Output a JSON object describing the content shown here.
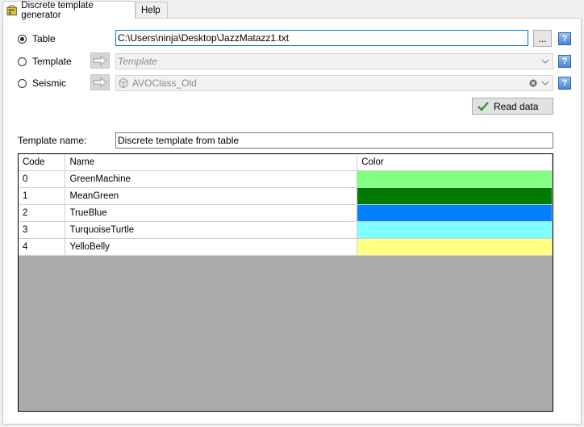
{
  "tabs": [
    {
      "label": "Discrete template generator",
      "active": true
    },
    {
      "label": "Help",
      "active": false
    }
  ],
  "source": {
    "table_label": "Table",
    "template_label": "Template",
    "seismic_label": "Seismic",
    "table_path": "C:\\Users\\ninja\\Desktop\\JazzMatazz1.txt",
    "browse_label": "...",
    "template_placeholder": "Template",
    "seismic_value": "AVOClass_Old",
    "selected": "Table"
  },
  "read_data_label": "Read data",
  "template_name": {
    "label": "Template name:",
    "value": "Discrete template from table"
  },
  "grid": {
    "columns": [
      "Code",
      "Name",
      "Color"
    ],
    "rows": [
      {
        "code": "0",
        "name": "GreenMachine",
        "color": "#80ff80"
      },
      {
        "code": "1",
        "name": "MeanGreen",
        "color": "#007a00"
      },
      {
        "code": "2",
        "name": "TrueBlue",
        "color": "#0080ff"
      },
      {
        "code": "3",
        "name": "TurquoiseTurtle",
        "color": "#80ffff"
      },
      {
        "code": "4",
        "name": "YelloBelly",
        "color": "#ffff80"
      }
    ]
  },
  "help_label": "?"
}
